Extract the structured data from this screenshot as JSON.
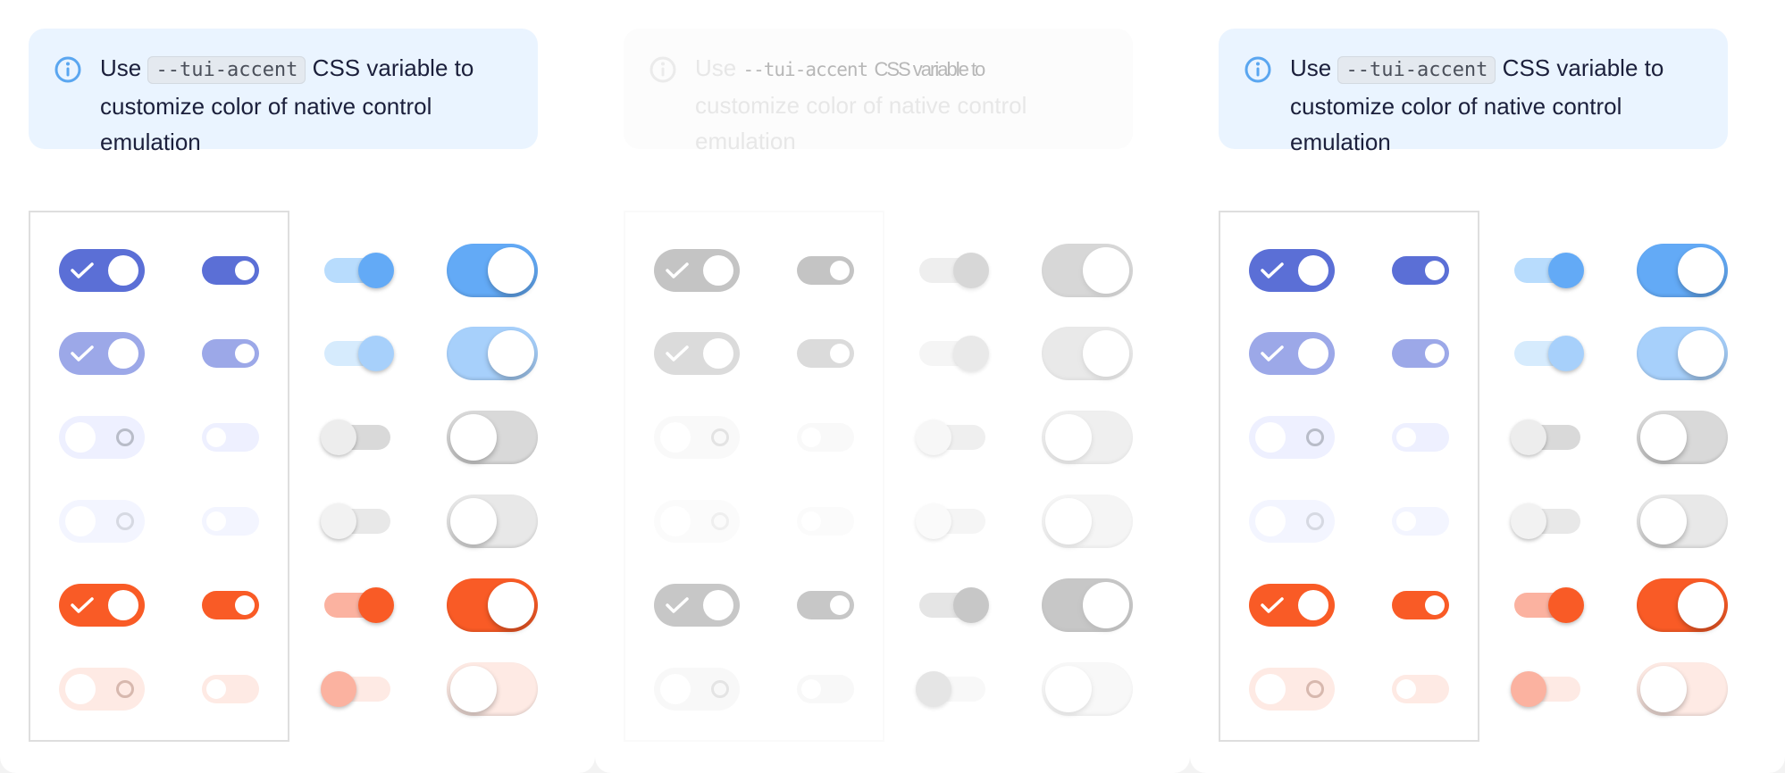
{
  "colors": {
    "accent_blue": "#5b6fd6",
    "accent_blue_light": "#9ca8e8",
    "accent_blue_pale": "#eef0ff",
    "sky": "#63aaf6",
    "sky_light": "#a7d0fb",
    "sky_track": "#b8dcfd",
    "gray_track": "#d9d9d9",
    "gray_track_light": "#e8e8e8",
    "orange": "#f95b26",
    "orange_light": "#fbb2a0",
    "orange_pale": "#feeae4",
    "notice_bg": "#eaf4ff",
    "info_icon": "#5aa6f0"
  },
  "notice": {
    "prefix": "Use",
    "code": "--tui-accent",
    "suffix": "CSS variable to customize color of native control emulation"
  },
  "notice_overlay": {
    "code": "--tui-accent",
    "rest": "CSS variable to"
  },
  "rows": [
    {
      "state": "checked"
    },
    {
      "state": "checked-disabled"
    },
    {
      "state": "unchecked"
    },
    {
      "state": "unchecked-disabled"
    },
    {
      "state": "checked-invalid"
    },
    {
      "state": "unchecked-invalid-disabled"
    }
  ]
}
